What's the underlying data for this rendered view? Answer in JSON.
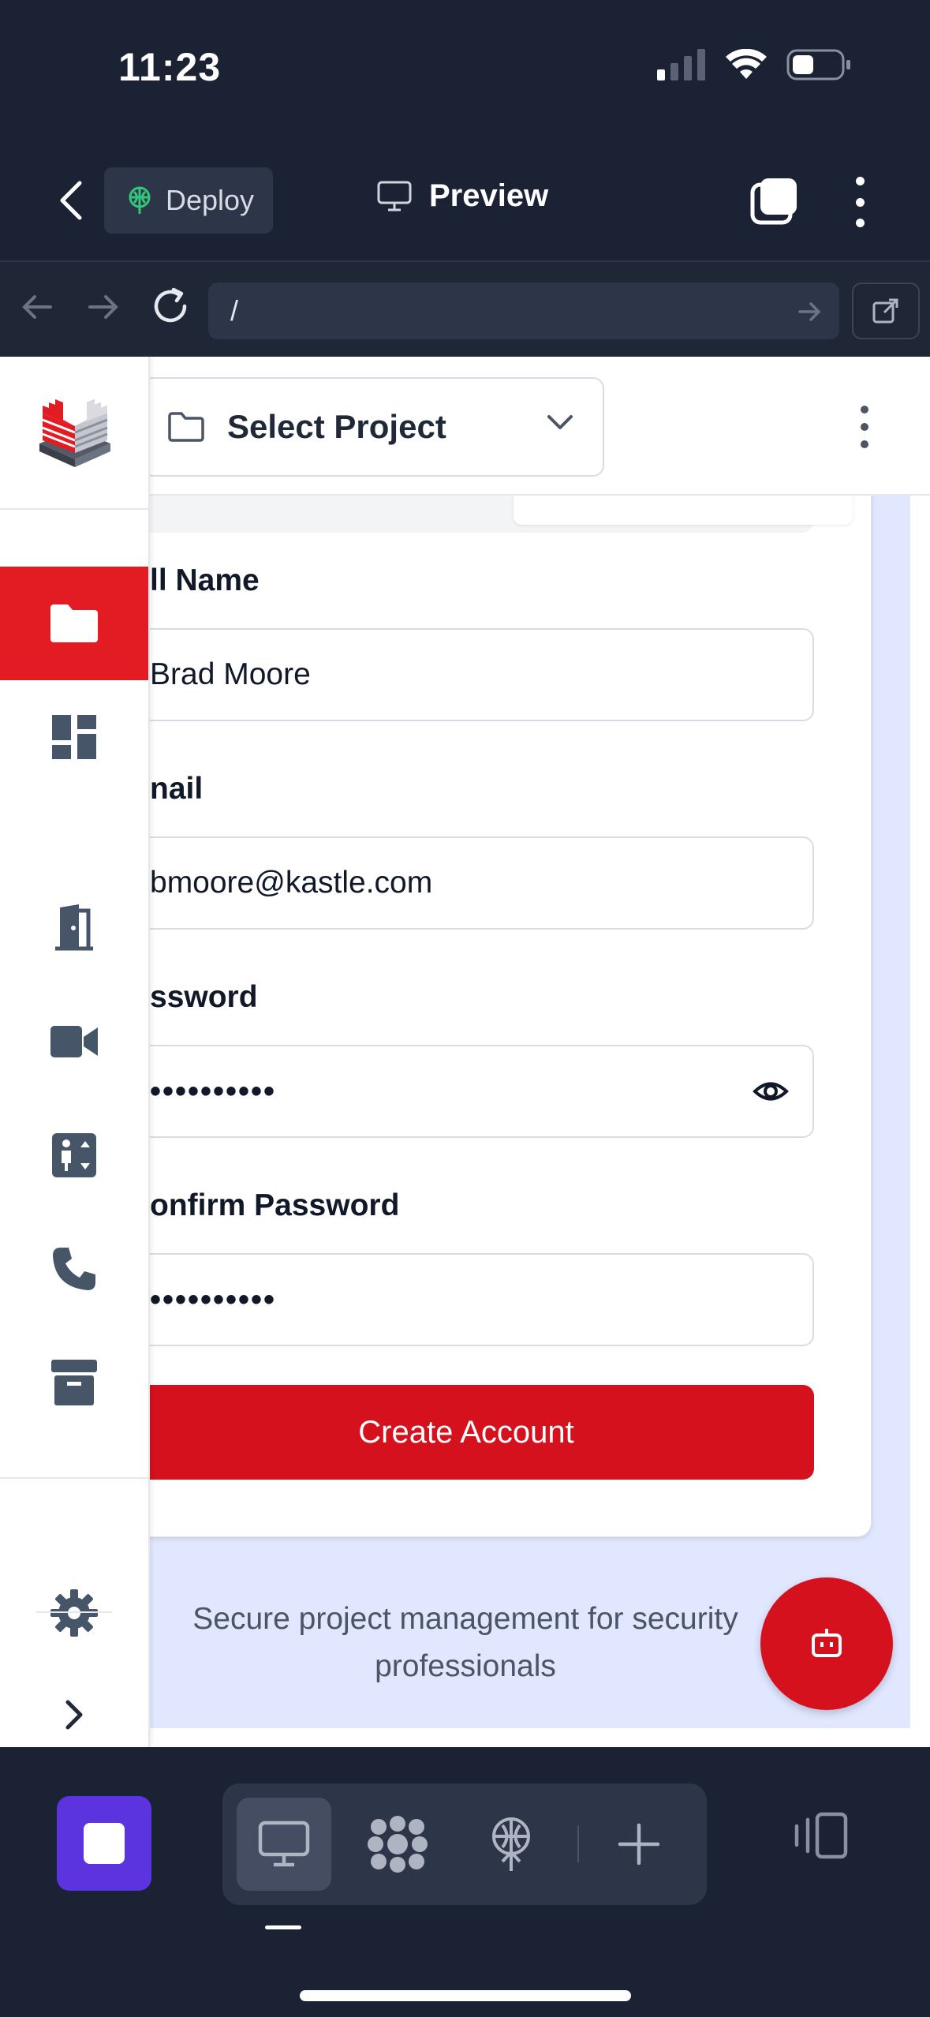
{
  "status_bar": {
    "time": "11:23"
  },
  "app_bar": {
    "deploy_label": "Deploy",
    "preview_label": "Preview"
  },
  "url_bar": {
    "url": "/"
  },
  "header": {
    "project_select_label": "Select Project"
  },
  "form": {
    "full_name_label": "ll Name",
    "full_name_value": "Brad Moore",
    "email_label": "nail",
    "email_value": "bmoore@kastle.com",
    "password_label": "ssword",
    "password_value": "••••••••••",
    "confirm_label": "onfirm Password",
    "confirm_value": "••••••••••",
    "submit_label": "Create Account"
  },
  "tagline": "Secure project management for security professionals",
  "sidebar": {
    "items": [
      "folder-icon",
      "dashboard-icon",
      "door-icon",
      "video-icon",
      "elevator-icon",
      "phone-icon",
      "archive-icon",
      "gear-icon",
      "chevron-right-icon"
    ],
    "active_item": "folder-icon"
  },
  "colors": {
    "brand_red": "#d4111c",
    "sidebar_active": "#e31b23",
    "stop_purple": "#5b34e0",
    "content_bg": "#e0e7ff"
  }
}
